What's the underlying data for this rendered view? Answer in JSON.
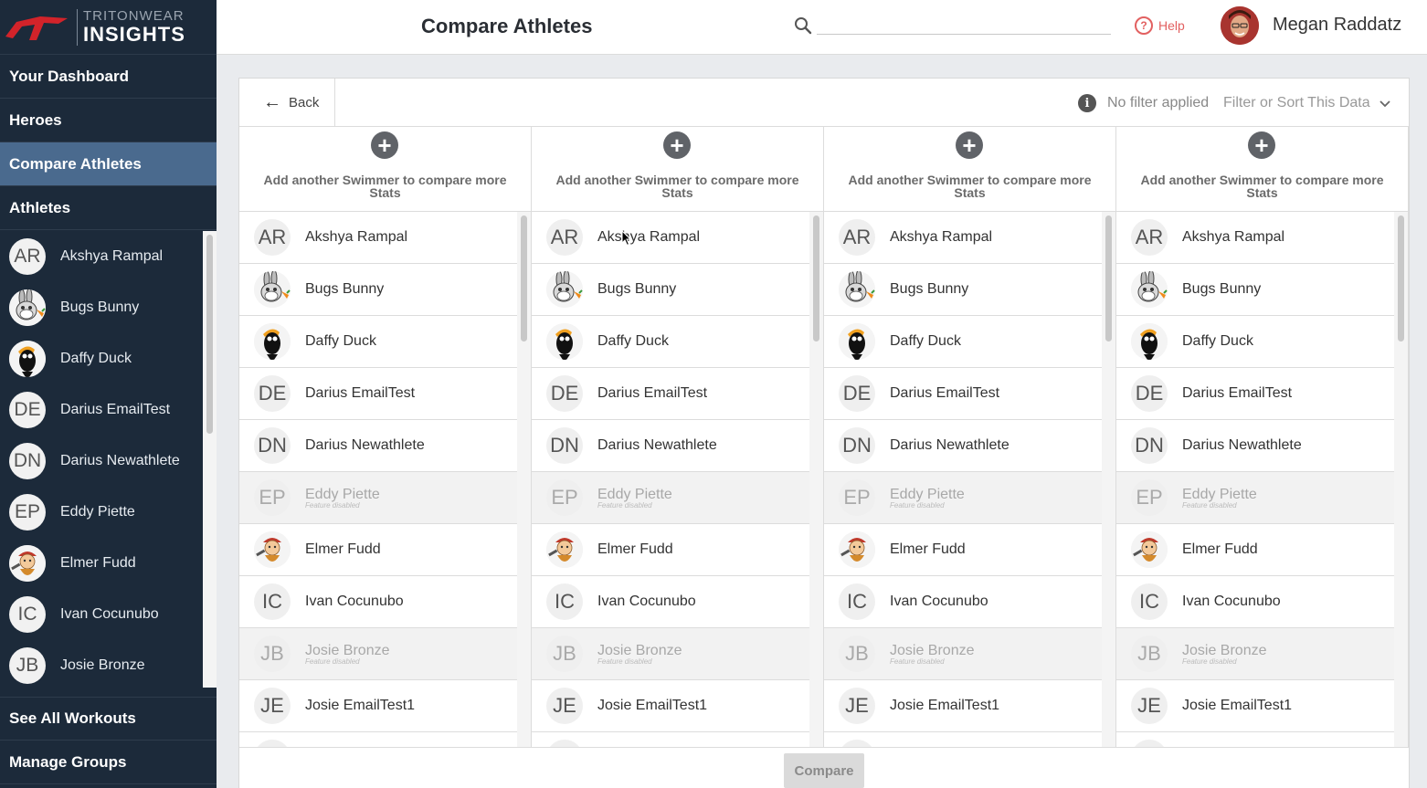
{
  "app": {
    "logo_top": "TRITONWEAR",
    "logo_bottom": "INSIGHTS"
  },
  "sidebar": {
    "nav": [
      {
        "label": "Your Dashboard"
      },
      {
        "label": "Heroes"
      },
      {
        "label": "Compare Athletes",
        "active": true
      },
      {
        "label": "Athletes"
      }
    ],
    "athletes": [
      {
        "initials": "AR",
        "name": "Akshya Rampal"
      },
      {
        "initials": "",
        "name": "Bugs Bunny",
        "icon": "bugs-bunny-avatar"
      },
      {
        "initials": "",
        "name": "Daffy Duck",
        "icon": "daffy-duck-avatar"
      },
      {
        "initials": "DE",
        "name": "Darius EmailTest"
      },
      {
        "initials": "DN",
        "name": "Darius Newathlete"
      },
      {
        "initials": "EP",
        "name": "Eddy Piette"
      },
      {
        "initials": "",
        "name": "Elmer Fudd",
        "icon": "elmer-fudd-avatar"
      },
      {
        "initials": "IC",
        "name": "Ivan Cocunubo"
      },
      {
        "initials": "JB",
        "name": "Josie Bronze"
      }
    ],
    "bottom_nav": [
      {
        "label": "See All Workouts"
      },
      {
        "label": "Manage Groups"
      }
    ]
  },
  "header": {
    "title": "Compare Athletes",
    "search_placeholder": "",
    "help_label": "Help",
    "user_name": "Megan Raddatz"
  },
  "toolbar": {
    "back_label": "Back",
    "filter_status": "No filter applied",
    "filter_sort_label": "Filter or Sort This Data"
  },
  "columns": [
    {
      "add_label": "Add another Swimmer to compare more Stats"
    },
    {
      "add_label": "Add another Swimmer to compare more Stats"
    },
    {
      "add_label": "Add another Swimmer to compare more Stats"
    },
    {
      "add_label": "Add another Swimmer to compare more Stats"
    }
  ],
  "roster": [
    {
      "initials": "AR",
      "name": "Akshya Rampal",
      "disabled": false
    },
    {
      "initials": "",
      "name": "Bugs Bunny",
      "disabled": false,
      "icon": "bugs-bunny-avatar"
    },
    {
      "initials": "",
      "name": "Daffy Duck",
      "disabled": false,
      "icon": "daffy-duck-avatar"
    },
    {
      "initials": "DE",
      "name": "Darius EmailTest",
      "disabled": false
    },
    {
      "initials": "DN",
      "name": "Darius Newathlete",
      "disabled": false
    },
    {
      "initials": "EP",
      "name": "Eddy Piette",
      "disabled": true,
      "note": "Feature disabled"
    },
    {
      "initials": "",
      "name": "Elmer Fudd",
      "disabled": false,
      "icon": "elmer-fudd-avatar"
    },
    {
      "initials": "IC",
      "name": "Ivan Cocunubo",
      "disabled": false
    },
    {
      "initials": "JB",
      "name": "Josie Bronze",
      "disabled": true,
      "note": "Feature disabled"
    },
    {
      "initials": "JE",
      "name": "Josie EmailTest1",
      "disabled": false
    },
    {
      "initials": "",
      "name": "",
      "disabled": false
    }
  ],
  "footer": {
    "compare_label": "Compare"
  },
  "colors": {
    "sidebar_bg": "#1c2a3a",
    "sidebar_active": "#4a6a8e",
    "help": "#e26060",
    "brand_red": "#d2232a"
  }
}
